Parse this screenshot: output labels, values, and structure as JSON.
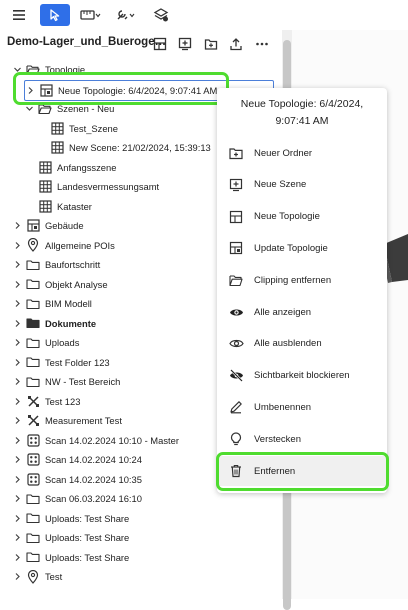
{
  "toolbar": {
    "items": [
      {
        "name": "menu-icon"
      },
      {
        "name": "pointer-icon",
        "active": true
      },
      {
        "name": "ruler-icon"
      },
      {
        "name": "tools-icon"
      },
      {
        "name": "layers-icon"
      }
    ]
  },
  "panel": {
    "title": "Demo-Lager_und_Bueroge…",
    "actions": [
      "new-topology-icon",
      "add-scene-icon",
      "add-folder-icon",
      "upload-icon",
      "more-icon"
    ]
  },
  "tree": [
    {
      "label": "Topologie",
      "icon": "folder-open",
      "chev": "down",
      "indent": 0
    },
    {
      "label": "Neue Topologie: 6/4/2024, 9:07:41 AM",
      "icon": "topology",
      "chev": "right",
      "indent": 1,
      "selected": true
    },
    {
      "label": "Szenen - Neu",
      "icon": "folder-open",
      "chev": "down",
      "indent": 1
    },
    {
      "label": "Test_Szene",
      "icon": "scene",
      "chev": "",
      "indent": 2
    },
    {
      "label": "New Scene: 21/02/2024, 15:39:13",
      "icon": "scene",
      "chev": "",
      "indent": 2
    },
    {
      "label": "Anfangsszene",
      "icon": "scene",
      "chev": "",
      "indent": 1
    },
    {
      "label": "Landesvermessungsamt",
      "icon": "scene",
      "chev": "",
      "indent": 1
    },
    {
      "label": "Kataster",
      "icon": "scene",
      "chev": "",
      "indent": 1
    },
    {
      "label": "Gebäude",
      "icon": "topology",
      "chev": "right",
      "indent": 0
    },
    {
      "label": "Allgemeine POIs",
      "icon": "pin",
      "chev": "right",
      "indent": 0
    },
    {
      "label": "Baufortschritt",
      "icon": "folder",
      "chev": "right",
      "indent": 0
    },
    {
      "label": "Objekt Analyse",
      "icon": "folder",
      "chev": "right",
      "indent": 0
    },
    {
      "label": "BIM Modell",
      "icon": "folder",
      "chev": "right",
      "indent": 0
    },
    {
      "label": "Dokumente",
      "icon": "folder-filled",
      "chev": "right",
      "indent": 0,
      "bold": true
    },
    {
      "label": "Uploads",
      "icon": "folder",
      "chev": "right",
      "indent": 0
    },
    {
      "label": "Test Folder 123",
      "icon": "folder",
      "chev": "right",
      "indent": 0
    },
    {
      "label": "NW - Test Bereich",
      "icon": "folder",
      "chev": "right",
      "indent": 0
    },
    {
      "label": "Test 123",
      "icon": "measure",
      "chev": "right",
      "indent": 0
    },
    {
      "label": "Measurement Test",
      "icon": "measure",
      "chev": "right",
      "indent": 0
    },
    {
      "label": "Scan 14.02.2024 10:10 - Master",
      "icon": "scan",
      "chev": "right",
      "indent": 0
    },
    {
      "label": "Scan 14.02.2024 10:24",
      "icon": "scan",
      "chev": "right",
      "indent": 0
    },
    {
      "label": "Scan 14.02.2024 10:35",
      "icon": "scan",
      "chev": "right",
      "indent": 0
    },
    {
      "label": "Scan 06.03.2024 16:10",
      "icon": "folder",
      "chev": "right",
      "indent": 0
    },
    {
      "label": "Uploads: Test Share",
      "icon": "folder",
      "chev": "right",
      "indent": 0
    },
    {
      "label": "Uploads: Test Share",
      "icon": "folder",
      "chev": "right",
      "indent": 0
    },
    {
      "label": "Uploads: Test Share",
      "icon": "folder",
      "chev": "right",
      "indent": 0
    },
    {
      "label": "Test",
      "icon": "pin",
      "chev": "right",
      "indent": 0
    }
  ],
  "context_menu": {
    "title_line1": "Neue Topologie: 6/4/2024,",
    "title_line2": "9:07:41 AM",
    "items": [
      {
        "label": "Neuer Ordner",
        "icon": "new-folder-icon"
      },
      {
        "label": "Neue Szene",
        "icon": "new-scene-icon"
      },
      {
        "label": "Neue Topologie",
        "icon": "new-topology-icon"
      },
      {
        "label": "Update Topologie",
        "icon": "update-topology-icon"
      },
      {
        "label": "Clipping entfernen",
        "icon": "clipping-folder-icon"
      },
      {
        "label": "Alle anzeigen",
        "icon": "eye-filled-icon"
      },
      {
        "label": "Alle ausblenden",
        "icon": "eye-outline-icon"
      },
      {
        "label": "Sichtbarkeit blockieren",
        "icon": "eye-off-icon"
      },
      {
        "label": "Umbenennen",
        "icon": "pencil-icon"
      },
      {
        "label": "Verstecken",
        "icon": "lightbulb-icon"
      },
      {
        "label": "Entfernen",
        "icon": "trash-icon",
        "hover": true
      }
    ]
  },
  "colors": {
    "accent": "#2f6fe8",
    "highlight": "#4fdc2f",
    "selection_border": "#4c7fd9"
  }
}
